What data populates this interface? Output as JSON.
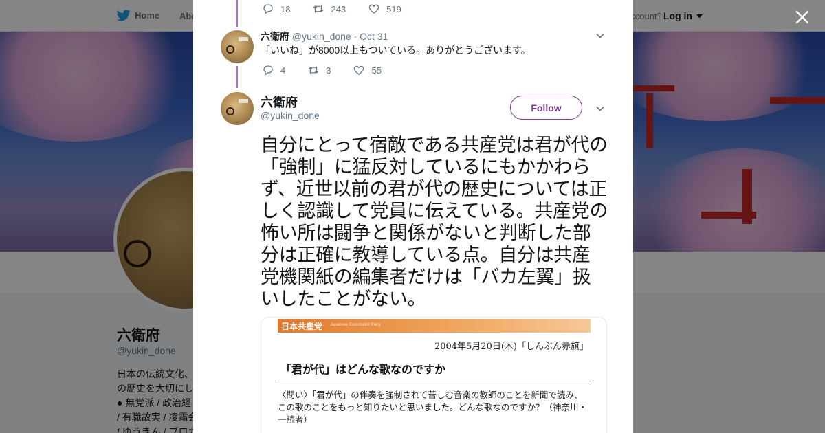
{
  "topnav": {
    "home_label": "Home",
    "about_label": "Abo",
    "account_prompt": "account?",
    "login_label": "Log in"
  },
  "profile": {
    "name": "六衛府",
    "handle": "@yukin_done",
    "bio": "日本の伝統文化、\nの歴史を大切にし\n● 無党派 / 政治経\n/ 有職故実 / 凌霜会\n/ ゆうきん / ブロガ"
  },
  "thread": {
    "previous_actions": {
      "replies": "18",
      "retweets": "243",
      "likes": "519"
    },
    "reply": {
      "name": "六衛府",
      "handle": "@yukin_done",
      "separator": "·",
      "date": "Oct 31",
      "text": "「いいね」が8000以上もついている。ありがとうございます。",
      "actions": {
        "replies": "4",
        "retweets": "3",
        "likes": "55"
      }
    }
  },
  "main_tweet": {
    "name": "六衛府",
    "handle": "@yukin_done",
    "follow_label": "Follow",
    "text": "自分にとって宿敵である共産党は君が代の「強制」に猛反対しているにもかかわらず、近世以前の君が代の歴史については正しく認識して党員に伝えている。共産党の怖い所は闘争と関係がないと判断した部分は正確に教導している点。自分は共産党機関紙の編集者だけは「バカ左翼」扱いしたことがない。"
  },
  "media": {
    "org_name": "日本共産党",
    "org_name_en": "Japanese Communist Party",
    "date_line": "2004年5月20日(木)「しんぶん赤旗」",
    "title": "「君が代」はどんな歌なのですか",
    "question": "〈問い〉「君が代」の伴奏を強制されて苦しむ音楽の教師のことを新聞で読み、この歌のことをもっと知りたいと思いました。どんな歌なのですか？（神奈川・一読者）"
  },
  "colors": {
    "accent": "#7e3b93",
    "thread_line": "#a974c6",
    "overlay": "rgba(0,0,0,0.48)",
    "twitter_blue": "#1da1f2"
  },
  "icons": [
    "twitter-bird-icon",
    "caret-down-icon",
    "close-icon",
    "reply-icon",
    "retweet-icon",
    "like-icon",
    "chevron-down-icon"
  ]
}
